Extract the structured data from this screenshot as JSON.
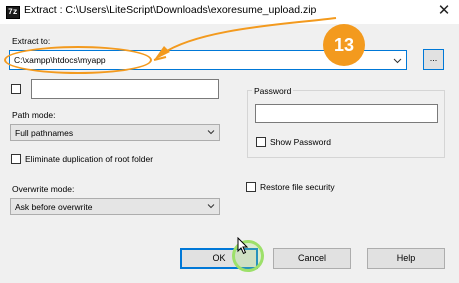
{
  "window": {
    "app_icon_text": "7z",
    "title": "Extract : C:\\Users\\LiteScript\\Downloads\\exoresume_upload.zip",
    "close_glyph": "✕"
  },
  "extract_to": {
    "label": "Extract to:",
    "value": "C:\\xampp\\htdocs\\myapp",
    "browse_label": "..."
  },
  "extra_field": {
    "value": ""
  },
  "path_mode": {
    "label": "Path mode:",
    "selected": "Full pathnames"
  },
  "eliminate_duplication": {
    "label": "Eliminate duplication of root folder",
    "checked": false
  },
  "overwrite_mode": {
    "label": "Overwrite mode:",
    "selected": "Ask before overwrite"
  },
  "password": {
    "label": "Password",
    "value": "",
    "show_label": "Show Password",
    "show_checked": false
  },
  "restore_security": {
    "label": "Restore file security",
    "checked": false
  },
  "buttons": {
    "ok": "OK",
    "cancel": "Cancel",
    "help": "Help"
  },
  "annotation": {
    "step_number": "13",
    "color": "#f39a1e",
    "click_highlight_color": "#9de06a"
  },
  "colors": {
    "focus_border": "#0078d7",
    "dialog_background": "#f0f0f0"
  }
}
